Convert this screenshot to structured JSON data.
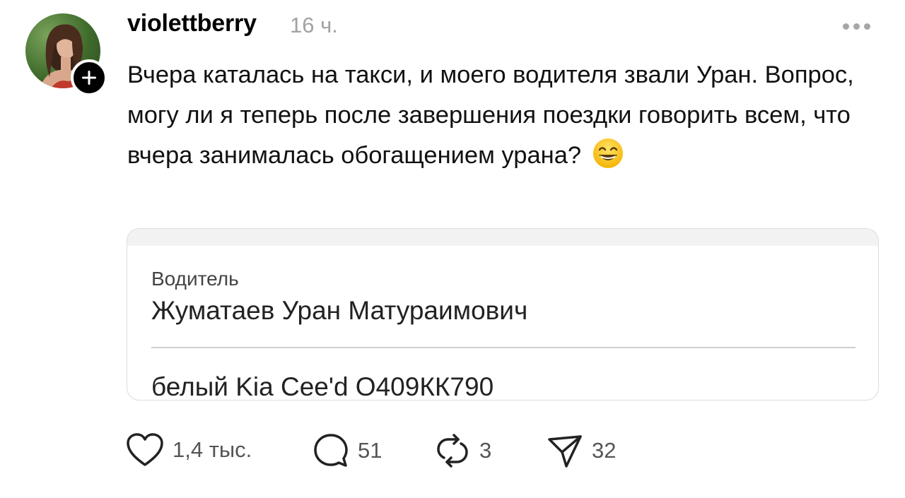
{
  "post": {
    "username": "violettberry",
    "time": "16 ч.",
    "text": "Вчера каталась на такси, и моего водителя звали Уран. Вопрос, могу ли я теперь после завершения поездки говорить всем, что вчера занималась обогащением урана?",
    "emoji": "grinning-face-with-smiling-eyes"
  },
  "card": {
    "driver_label": "Водитель",
    "driver_name": "Жуматаев Уран Матураимович",
    "car_info": "белый Kia Cee'd О409КК790"
  },
  "actions": {
    "likes": "1,4 тыс.",
    "replies": "51",
    "reposts": "3",
    "shares": "32"
  },
  "icons": [
    "heart-icon",
    "comment-icon",
    "repost-icon",
    "share-icon",
    "more-icon",
    "plus-icon"
  ],
  "colors": {
    "text": "#111111",
    "muted": "#a2a2a2",
    "follow_badge": "#000000"
  }
}
